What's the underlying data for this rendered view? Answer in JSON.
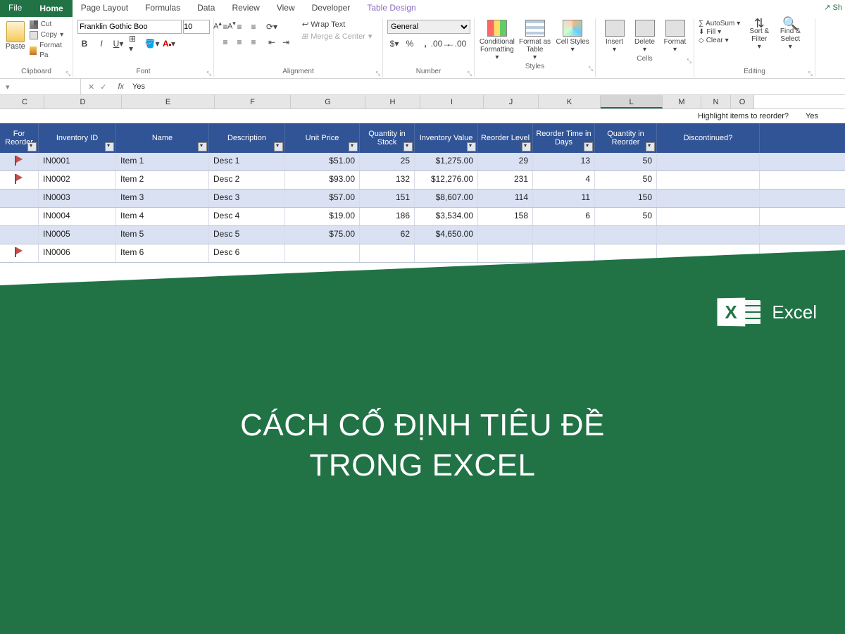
{
  "tabs": {
    "file": "File",
    "home": "Home",
    "page_layout": "Page Layout",
    "formulas": "Formulas",
    "data": "Data",
    "review": "Review",
    "view": "View",
    "developer": "Developer",
    "table_design": "Table Design",
    "share": "Sh"
  },
  "ribbon": {
    "clipboard": {
      "paste": "Paste",
      "cut": "Cut",
      "copy": "Copy",
      "format_painter": "Format Pa",
      "label": "Clipboard"
    },
    "font": {
      "name": "Franklin Gothic Boo",
      "size": "10",
      "label": "Font"
    },
    "alignment": {
      "wrap": "Wrap Text",
      "merge": "Merge & Center",
      "label": "Alignment"
    },
    "number": {
      "format": "General",
      "label": "Number"
    },
    "styles": {
      "cond": "Conditional Formatting",
      "fmt_table": "Format as Table",
      "cell_styles": "Cell Styles",
      "label": "Styles"
    },
    "cells": {
      "insert": "Insert",
      "delete": "Delete",
      "format": "Format",
      "label": "Cells"
    },
    "editing": {
      "autosum": "AutoSum",
      "fill": "Fill",
      "clear": "Clear",
      "sort": "Sort & Filter",
      "find": "Find & Select",
      "label": "Editing"
    }
  },
  "formula_bar": {
    "value": "Yes"
  },
  "col_headers": [
    "C",
    "D",
    "E",
    "F",
    "G",
    "H",
    "I",
    "J",
    "K",
    "L",
    "M",
    "N",
    "O"
  ],
  "annotation": {
    "question": "Highlight items to reorder?",
    "answer": "Yes"
  },
  "table": {
    "headers": [
      "For Reorder",
      "Inventory ID",
      "Name",
      "Description",
      "Unit Price",
      "Quantity in Stock",
      "Inventory Value",
      "Reorder Level",
      "Reorder Time in Days",
      "Quantity in Reorder",
      "Discontinued?"
    ],
    "rows": [
      {
        "flag": true,
        "id": "IN0001",
        "name": "Item 1",
        "desc": "Desc 1",
        "price": "$51.00",
        "qty": "25",
        "value": "$1,275.00",
        "reorder": "29",
        "days": "13",
        "qreorder": "50",
        "disc": ""
      },
      {
        "flag": true,
        "id": "IN0002",
        "name": "Item 2",
        "desc": "Desc 2",
        "price": "$93.00",
        "qty": "132",
        "value": "$12,276.00",
        "reorder": "231",
        "days": "4",
        "qreorder": "50",
        "disc": ""
      },
      {
        "flag": false,
        "id": "IN0003",
        "name": "Item 3",
        "desc": "Desc 3",
        "price": "$57.00",
        "qty": "151",
        "value": "$8,607.00",
        "reorder": "114",
        "days": "11",
        "qreorder": "150",
        "disc": ""
      },
      {
        "flag": false,
        "id": "IN0004",
        "name": "Item 4",
        "desc": "Desc 4",
        "price": "$19.00",
        "qty": "186",
        "value": "$3,534.00",
        "reorder": "158",
        "days": "6",
        "qreorder": "50",
        "disc": ""
      },
      {
        "flag": false,
        "id": "IN0005",
        "name": "Item 5",
        "desc": "Desc 5",
        "price": "$75.00",
        "qty": "62",
        "value": "$4,650.00",
        "reorder": "",
        "days": "",
        "qreorder": "",
        "disc": ""
      },
      {
        "flag": true,
        "id": "IN0006",
        "name": "Item 6",
        "desc": "Desc 6",
        "price": "",
        "qty": "",
        "value": "",
        "reorder": "",
        "days": "",
        "qreorder": "",
        "disc": ""
      }
    ]
  },
  "overlay": {
    "product": "Excel",
    "headline_l1": "CÁCH CỐ ĐỊNH TIÊU ĐỀ",
    "headline_l2": "TRONG EXCEL"
  }
}
